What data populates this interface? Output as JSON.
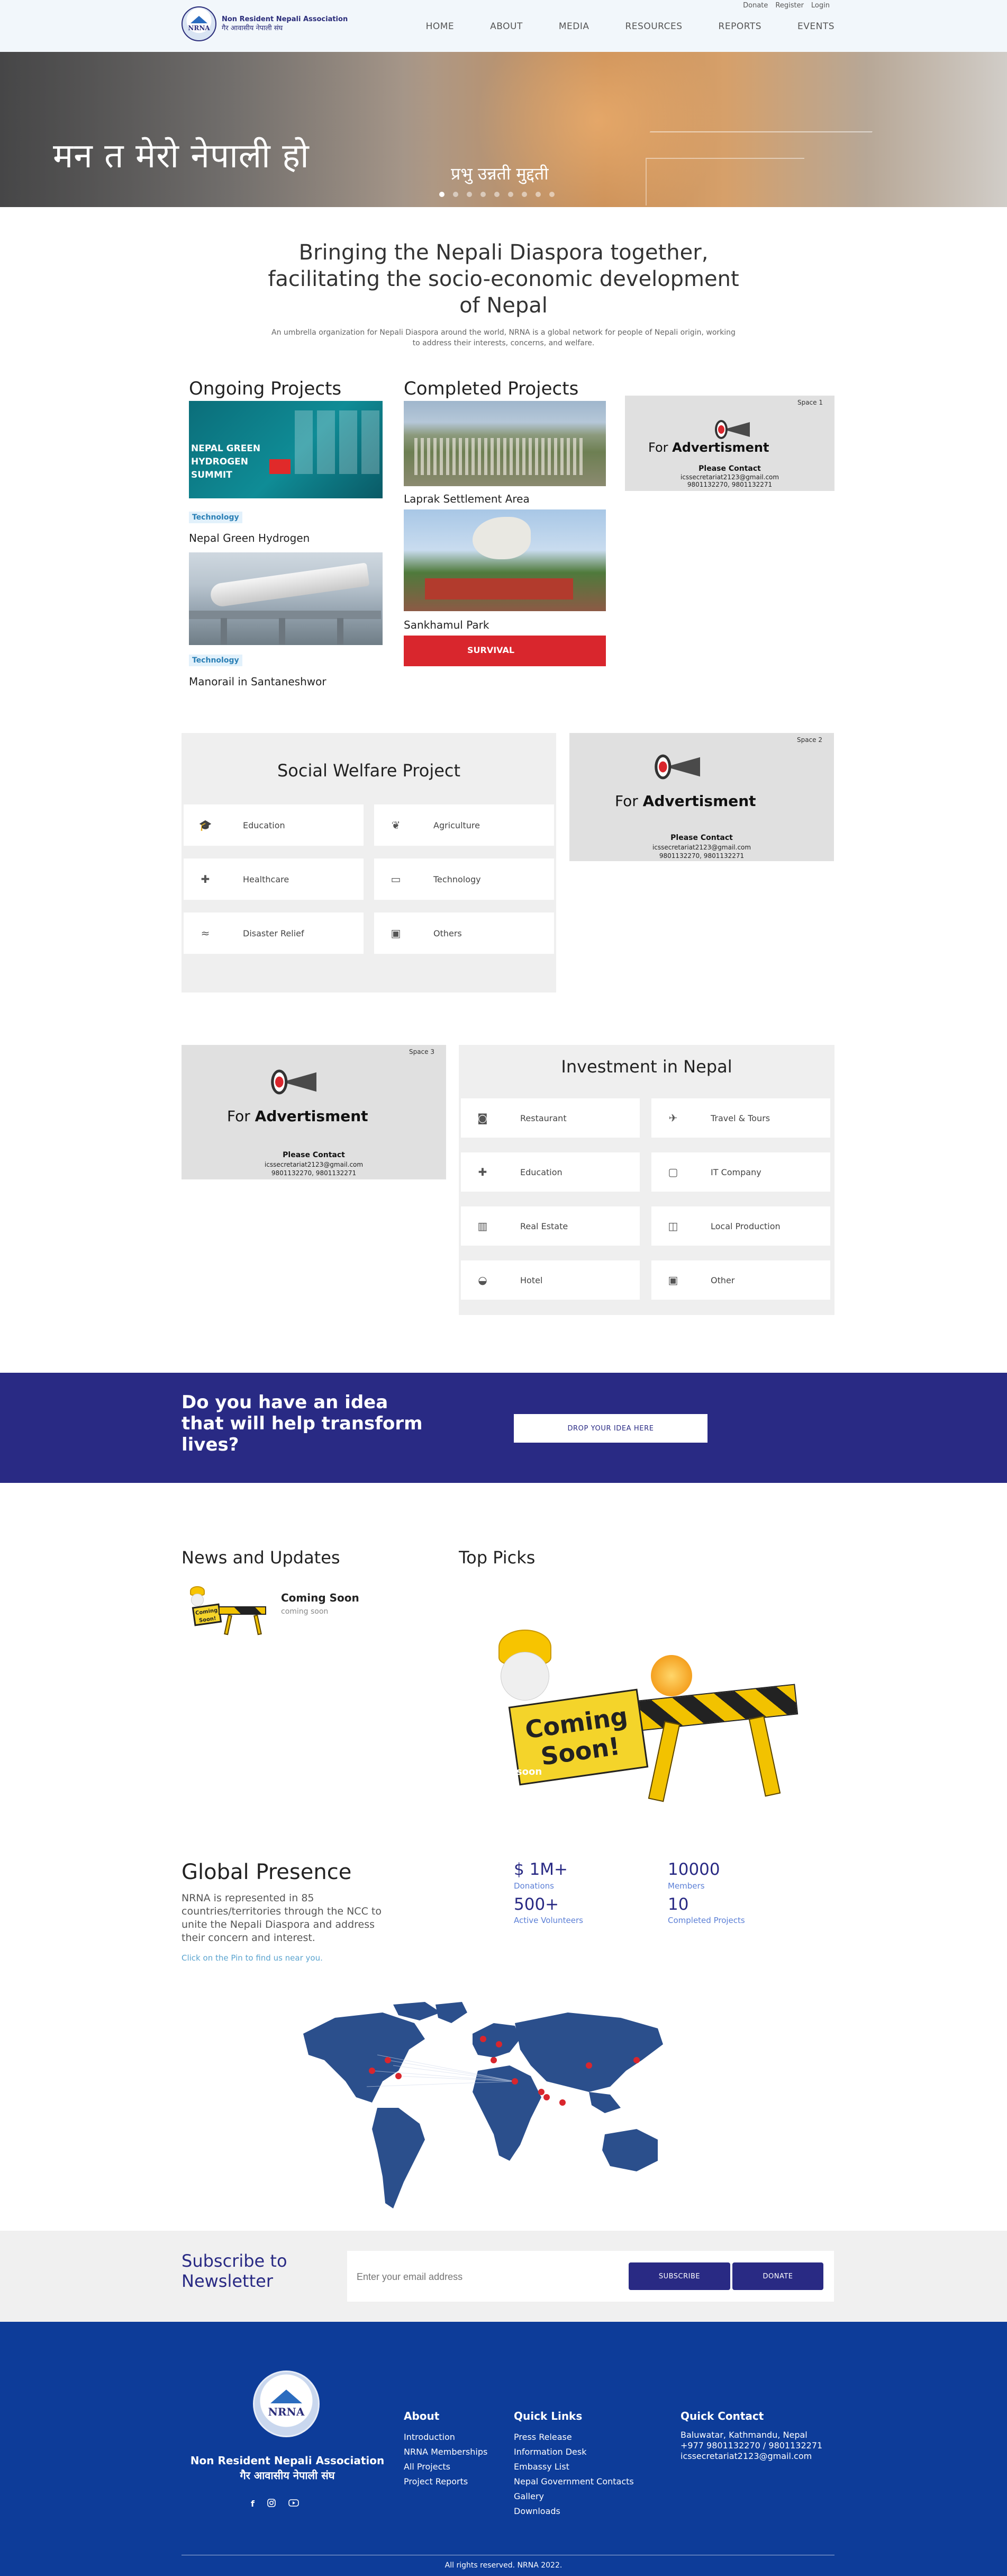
{
  "header": {
    "top_links": [
      "Donate",
      "Register",
      "Login"
    ],
    "logo_mark": "NRNA",
    "logo_name_en": "Non Resident Nepali Association",
    "logo_name_np": "गैर आवासीय नेपाली संघ",
    "nav": [
      "HOME",
      "ABOUT",
      "MEDIA",
      "RESOURCES",
      "REPORTS",
      "EVENTS"
    ]
  },
  "hero": {
    "main_text": "मन त मेरो नेपाली हो",
    "sub_text": "प्रभु उन्नती मुद्दती",
    "slide_count": 9,
    "active_slide": 1
  },
  "intro": {
    "title": "Bringing the Nepali Diaspora together, facilitating the socio-economic development of Nepal",
    "text": "An umbrella organization for Nepali Diaspora around the world, NRNA is a global network for people of Nepali origin, working to address their interests, concerns, and welfare."
  },
  "projects": {
    "ongoing_heading": "Ongoing Projects",
    "completed_heading": "Completed Projects",
    "ongoing": [
      {
        "tag": "Technology",
        "title": "Nepal Green Hydrogen",
        "image_text": "NEPAL GREEN HYDROGEN SUMMIT"
      },
      {
        "tag": "Technology",
        "title": "Manorail in Santaneshwor"
      }
    ],
    "completed": [
      {
        "title": "Laprak Settlement Area"
      },
      {
        "title": "Sankhamul Park"
      },
      {
        "image_text": "SURVIVAL"
      }
    ]
  },
  "ads": [
    {
      "space": "Space 1",
      "label_thin": "For",
      "label_bold": "Advertisment",
      "contact": "Please Contact",
      "email": "icssecretariat2123@gmail.com",
      "phone": "9801132270, 9801132271"
    },
    {
      "space": "Space 2",
      "label_thin": "For",
      "label_bold": "Advertisment",
      "contact": "Please Contact",
      "email": "icssecretariat2123@gmail.com",
      "phone": "9801132270, 9801132271"
    },
    {
      "space": "Space 3",
      "label_thin": "For",
      "label_bold": "Advertisment",
      "contact": "Please Contact",
      "email": "icssecretariat2123@gmail.com",
      "phone": "9801132270, 9801132271"
    }
  ],
  "social_welfare": {
    "title": "Social Welfare Project",
    "items": [
      {
        "label": "Education",
        "icon": "graduation-cap-icon"
      },
      {
        "label": "Agriculture",
        "icon": "plant-icon"
      },
      {
        "label": "Healthcare",
        "icon": "medical-kit-icon"
      },
      {
        "label": "Technology",
        "icon": "laptop-icon"
      },
      {
        "label": "Disaster Relief",
        "icon": "flood-icon"
      },
      {
        "label": "Others",
        "icon": "image-icon"
      }
    ]
  },
  "investment": {
    "title": "Investment in Nepal",
    "items": [
      {
        "label": "Restaurant",
        "icon": "restaurant-icon"
      },
      {
        "label": "Travel & Tours",
        "icon": "globe-plane-icon"
      },
      {
        "label": "Education",
        "icon": "medical-kit-icon"
      },
      {
        "label": "IT Company",
        "icon": "monitor-icon"
      },
      {
        "label": "Real Estate",
        "icon": "building-icon"
      },
      {
        "label": "Local Production",
        "icon": "shopping-bag-icon"
      },
      {
        "label": "Hotel",
        "icon": "hotel-bell-icon"
      },
      {
        "label": "Other",
        "icon": "image-icon"
      }
    ]
  },
  "idea": {
    "heading": "Do you have an idea that will help transform lives?",
    "button": "DROP YOUR IDEA HERE"
  },
  "news": {
    "heading": "News and Updates",
    "item_title": "Coming Soon",
    "item_sub": "coming soon",
    "sign_text": "Coming Soon!"
  },
  "top_picks": {
    "heading": "Top Picks",
    "sign_text": "Coming Soon!",
    "caption": "coming soon"
  },
  "global": {
    "heading": "Global Presence",
    "text": "NRNA is represented in 85 countries/territories through the NCC to unite the Nepali Diaspora and address their concern and interest.",
    "link": "Click on the Pin to find us near you.",
    "stats": [
      {
        "value": "$ 1M+",
        "label": "Donations"
      },
      {
        "value": "10000",
        "label": "Members"
      },
      {
        "value": "500+",
        "label": "Active Volunteers"
      },
      {
        "value": "10",
        "label": "Completed Projects"
      }
    ]
  },
  "subscribe": {
    "heading": "Subscribe to Newsletter",
    "placeholder": "Enter your email address",
    "subscribe_button": "SUBSCRIBE",
    "donate_button": "DONATE"
  },
  "footer": {
    "logo_mark": "NRNA",
    "name_en": "Non Resident Nepali Association",
    "name_np": "गैर आवासीय नेपाली संघ",
    "social": [
      "facebook-icon",
      "instagram-icon",
      "youtube-icon"
    ],
    "about_heading": "About",
    "about_links": [
      "Introduction",
      "NRNA Memberships",
      "All Projects",
      "Project Reports"
    ],
    "quick_heading": "Quick Links",
    "quick_links": [
      "Press Release",
      "Information Desk",
      "Embassy List",
      "Nepal Government Contacts",
      "Gallery",
      "Downloads"
    ],
    "contact_heading": "Quick Contact",
    "contact_lines": [
      "Baluwatar, Kathmandu, Nepal",
      "+977 9801132270 / 9801132271",
      "icssecretariat2123@gmail.com"
    ],
    "copyright": "All rights reserved. NRNA 2022."
  },
  "colors": {
    "brand": "#292a84",
    "footer": "#0d3c99",
    "accent_link": "#5ba4cf",
    "tag_bg": "#e2f1fb"
  }
}
